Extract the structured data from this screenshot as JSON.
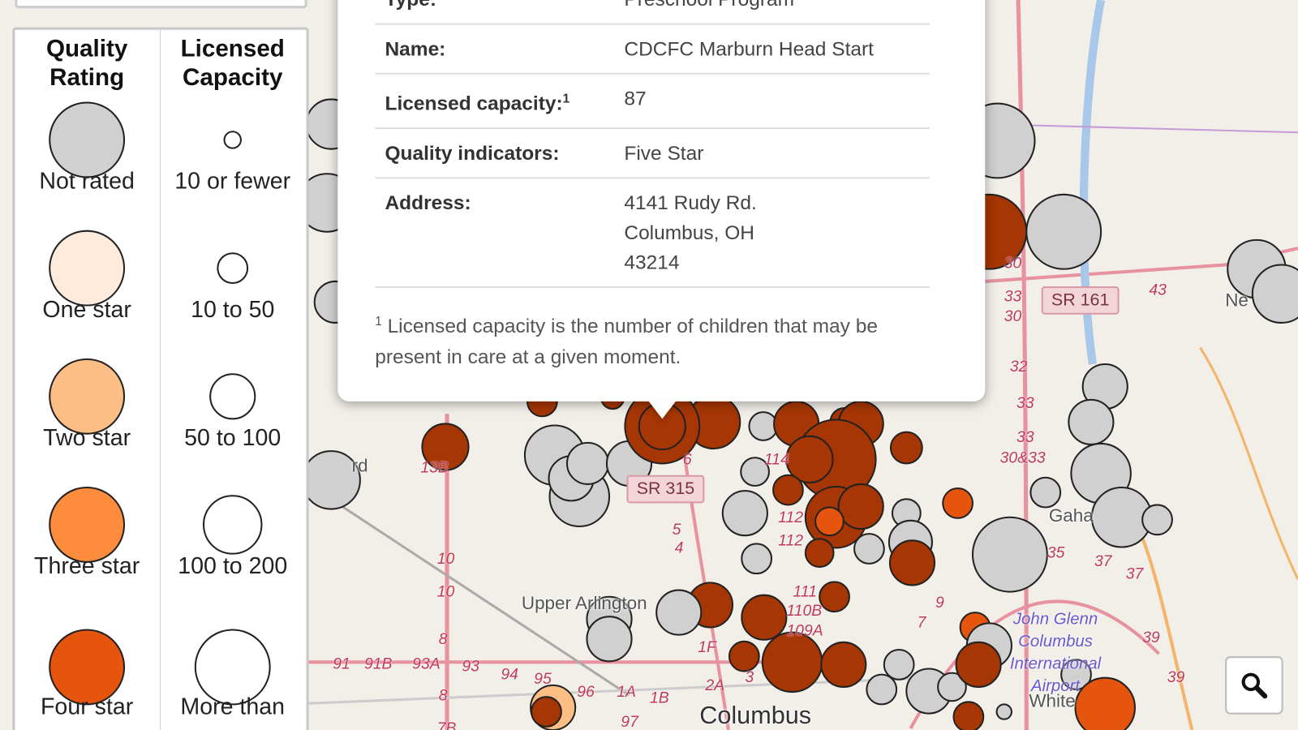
{
  "legend": {
    "quality_header": "Quality Rating",
    "capacity_header": "Licensed Capacity",
    "quality_items": [
      {
        "label": "Not rated",
        "color": "#d0d0d0"
      },
      {
        "label": "One star",
        "color": "#feebdc"
      },
      {
        "label": "Two star",
        "color": "#fdbe85"
      },
      {
        "label": "Three star",
        "color": "#fd8d3c"
      },
      {
        "label": "Four star",
        "color": "#e6550d"
      }
    ],
    "capacity_items": [
      {
        "label": "10 or fewer"
      },
      {
        "label": "10 to 50"
      },
      {
        "label": "50 to 100"
      },
      {
        "label": "100 to 200"
      },
      {
        "label": "More than"
      }
    ]
  },
  "popup": {
    "rows": [
      {
        "key": "Type:",
        "value": "Preschool Program"
      },
      {
        "key": "Name:",
        "value": "CDCFC Marburn Head Start"
      },
      {
        "key": "Licensed capacity:",
        "sup": "1",
        "value": "87"
      },
      {
        "key": "Quality indicators:",
        "value": "Five Star"
      },
      {
        "key": "Address:",
        "value_lines": [
          "4141 Rudy Rd.",
          "Columbus, OH",
          "43214"
        ]
      }
    ],
    "footnote_mark": "1",
    "footnote": "Licensed capacity is the number of children that may be present in care at a given moment."
  },
  "map": {
    "shields": [
      "SR 315",
      "SR 161"
    ],
    "places": [
      "Upper Arlington",
      "Columbus",
      "Gaha",
      "Ne",
      "White",
      "rd"
    ],
    "airport": [
      "John Glenn",
      "Columbus",
      "International",
      "Airport"
    ],
    "road_numbers": [
      "30",
      "33",
      "30",
      "43",
      "32",
      "33",
      "33",
      "30&33",
      "35",
      "37",
      "37",
      "39",
      "39",
      "10",
      "10",
      "8",
      "8",
      "91",
      "91B",
      "93A",
      "93",
      "94",
      "95",
      "96",
      "1A",
      "1B",
      "97",
      "2A",
      "3",
      "1F",
      "111",
      "110B",
      "109A",
      "112",
      "112",
      "114",
      "6",
      "5",
      "4",
      "13B",
      "7",
      "9",
      "7B"
    ],
    "marker_colors": {
      "dark": "#a63603",
      "four_star": "#e6550d",
      "not_rated": "#d0d0d0",
      "two_star": "#fdbe85"
    }
  },
  "controls": {
    "search_icon": "magnifier-icon"
  }
}
